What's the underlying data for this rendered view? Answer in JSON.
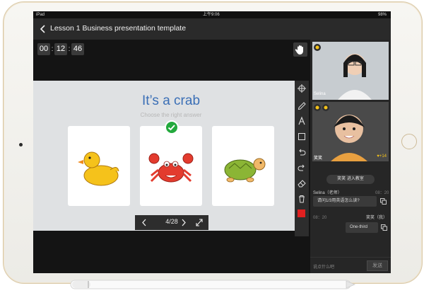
{
  "status_bar": {
    "carrier": "iPad",
    "time": "上午9:06",
    "battery": "98%"
  },
  "header": {
    "title": "Lesson 1 Business presentation template"
  },
  "timer": {
    "hours": "00",
    "minutes": "12",
    "seconds": "46",
    "separator": ":"
  },
  "slide": {
    "title": "It’s a crab",
    "subtitle": "Choose the right answer",
    "cards": [
      {
        "name": "duck",
        "selected": false
      },
      {
        "name": "crab",
        "selected": true
      },
      {
        "name": "turtle",
        "selected": false
      }
    ]
  },
  "pager": {
    "label": "4/28"
  },
  "tools": {
    "icons": [
      "crosshair-icon",
      "pencil-icon",
      "text-icon",
      "rectangle-icon",
      "undo-icon",
      "redo-icon",
      "eraser-icon",
      "trash-icon",
      "color-swatch"
    ],
    "active_color": "#e02020"
  },
  "videos": [
    {
      "name": "Selina",
      "badge": ""
    },
    {
      "name": "笑笑",
      "badge": "+14"
    }
  ],
  "chat": {
    "join_notice": "笑笑 进入教室",
    "messages": [
      {
        "sender": "Selina（老师）",
        "time": "08：20",
        "text": "请问1/3用英语怎么读?"
      },
      {
        "sender": "笑笑（我）",
        "time": "08：20",
        "text": "One-third"
      }
    ],
    "input_placeholder": "说点什么吧",
    "send_label": "发送"
  },
  "colors": {
    "accent_blue": "#3b6fb6",
    "correct_green": "#23a93d",
    "screen_bg": "#1a1a1a"
  }
}
